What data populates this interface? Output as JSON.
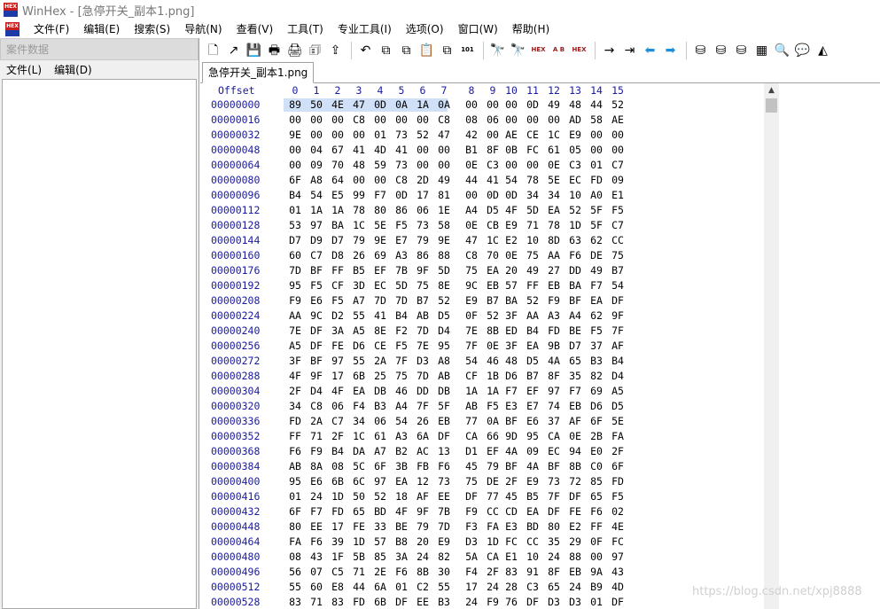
{
  "window": {
    "title": "WinHex - [急停开关_副本1.png]",
    "logo_text": "HEX"
  },
  "menu": [
    "文件(F)",
    "编辑(E)",
    "搜索(S)",
    "导航(N)",
    "查看(V)",
    "工具(T)",
    "专业工具(I)",
    "选项(O)",
    "窗口(W)",
    "帮助(H)"
  ],
  "left_panel": {
    "title": "案件数据",
    "menu": [
      "文件(L)",
      "编辑(D)"
    ]
  },
  "toolbar": {
    "groups": [
      [
        {
          "name": "new-file-icon",
          "glyph": "🗋"
        },
        {
          "name": "open-icon",
          "glyph": "↗"
        },
        {
          "name": "save-icon",
          "glyph": "💾"
        },
        {
          "name": "print-icon",
          "glyph": "🖶"
        },
        {
          "name": "properties-icon",
          "glyph": "🖨"
        },
        {
          "name": "open-disk-icon",
          "glyph": "🗊"
        },
        {
          "name": "export-icon",
          "glyph": "⇪"
        }
      ],
      [
        {
          "name": "undo-icon",
          "glyph": "↶"
        },
        {
          "name": "cut-icon",
          "glyph": "⧉"
        },
        {
          "name": "copy-icon",
          "glyph": "⧉"
        },
        {
          "name": "paste-icon",
          "glyph": "📋"
        },
        {
          "name": "write-icon",
          "glyph": "⧉"
        },
        {
          "name": "binary-icon",
          "glyph": "101"
        }
      ],
      [
        {
          "name": "find-icon",
          "glyph": "🔭"
        },
        {
          "name": "find-red-icon",
          "glyph": "🔭"
        },
        {
          "name": "find-hex-icon",
          "glyph": "HEX"
        },
        {
          "name": "replace-text-icon",
          "glyph": "A B"
        },
        {
          "name": "replace-hex-icon",
          "glyph": "HEX"
        }
      ],
      [
        {
          "name": "goto-arrow-icon",
          "glyph": "→"
        },
        {
          "name": "goto-offset-icon",
          "glyph": "⇥"
        },
        {
          "name": "back-icon",
          "glyph": "⬅"
        },
        {
          "name": "forward-icon",
          "glyph": "➡"
        }
      ],
      [
        {
          "name": "disk-editor-icon",
          "glyph": "⛁"
        },
        {
          "name": "disk-green-icon",
          "glyph": "⛁"
        },
        {
          "name": "disk-tool-icon",
          "glyph": "⛁"
        },
        {
          "name": "calculator-icon",
          "glyph": "▦"
        },
        {
          "name": "zoom-icon",
          "glyph": "🔍"
        },
        {
          "name": "speech-icon",
          "glyph": "💬"
        },
        {
          "name": "gray-shape-icon",
          "glyph": "◭"
        }
      ]
    ]
  },
  "tab": {
    "label": "急停开关_副本1.png"
  },
  "hex": {
    "offset_header": "Offset",
    "columns": [
      "0",
      "1",
      "2",
      "3",
      "4",
      "5",
      "6",
      "7",
      "8",
      "9",
      "10",
      "11",
      "12",
      "13",
      "14",
      "15"
    ],
    "rows": [
      {
        "offset": "00000000",
        "bytes": [
          "89",
          "50",
          "4E",
          "47",
          "0D",
          "0A",
          "1A",
          "0A",
          "00",
          "00",
          "00",
          "0D",
          "49",
          "48",
          "44",
          "52"
        ]
      },
      {
        "offset": "00000016",
        "bytes": [
          "00",
          "00",
          "00",
          "C8",
          "00",
          "00",
          "00",
          "C8",
          "08",
          "06",
          "00",
          "00",
          "00",
          "AD",
          "58",
          "AE"
        ]
      },
      {
        "offset": "00000032",
        "bytes": [
          "9E",
          "00",
          "00",
          "00",
          "01",
          "73",
          "52",
          "47",
          "42",
          "00",
          "AE",
          "CE",
          "1C",
          "E9",
          "00",
          "00"
        ]
      },
      {
        "offset": "00000048",
        "bytes": [
          "00",
          "04",
          "67",
          "41",
          "4D",
          "41",
          "00",
          "00",
          "B1",
          "8F",
          "0B",
          "FC",
          "61",
          "05",
          "00",
          "00"
        ]
      },
      {
        "offset": "00000064",
        "bytes": [
          "00",
          "09",
          "70",
          "48",
          "59",
          "73",
          "00",
          "00",
          "0E",
          "C3",
          "00",
          "00",
          "0E",
          "C3",
          "01",
          "C7"
        ]
      },
      {
        "offset": "00000080",
        "bytes": [
          "6F",
          "A8",
          "64",
          "00",
          "00",
          "C8",
          "2D",
          "49",
          "44",
          "41",
          "54",
          "78",
          "5E",
          "EC",
          "FD",
          "09"
        ]
      },
      {
        "offset": "00000096",
        "bytes": [
          "B4",
          "54",
          "E5",
          "99",
          "F7",
          "0D",
          "17",
          "81",
          "00",
          "0D",
          "0D",
          "34",
          "34",
          "10",
          "A0",
          "E1"
        ]
      },
      {
        "offset": "00000112",
        "bytes": [
          "01",
          "1A",
          "1A",
          "78",
          "80",
          "86",
          "06",
          "1E",
          "A4",
          "D5",
          "4F",
          "5D",
          "EA",
          "52",
          "5F",
          "F5"
        ]
      },
      {
        "offset": "00000128",
        "bytes": [
          "53",
          "97",
          "BA",
          "1C",
          "5E",
          "F5",
          "73",
          "58",
          "0E",
          "CB",
          "E9",
          "71",
          "78",
          "1D",
          "5F",
          "C7"
        ]
      },
      {
        "offset": "00000144",
        "bytes": [
          "D7",
          "D9",
          "D7",
          "79",
          "9E",
          "E7",
          "79",
          "9E",
          "47",
          "1C",
          "E2",
          "10",
          "8D",
          "63",
          "62",
          "CC"
        ]
      },
      {
        "offset": "00000160",
        "bytes": [
          "60",
          "C7",
          "D8",
          "26",
          "69",
          "A3",
          "86",
          "88",
          "C8",
          "70",
          "0E",
          "75",
          "AA",
          "F6",
          "DE",
          "75"
        ]
      },
      {
        "offset": "00000176",
        "bytes": [
          "7D",
          "BF",
          "FF",
          "B5",
          "EF",
          "7B",
          "9F",
          "5D",
          "75",
          "EA",
          "20",
          "49",
          "27",
          "DD",
          "49",
          "B7"
        ]
      },
      {
        "offset": "00000192",
        "bytes": [
          "95",
          "F5",
          "CF",
          "3D",
          "EC",
          "5D",
          "75",
          "8E",
          "9C",
          "EB",
          "57",
          "FF",
          "EB",
          "BA",
          "F7",
          "54"
        ]
      },
      {
        "offset": "00000208",
        "bytes": [
          "F9",
          "E6",
          "F5",
          "A7",
          "7D",
          "7D",
          "B7",
          "52",
          "E9",
          "B7",
          "BA",
          "52",
          "F9",
          "BF",
          "EA",
          "DF"
        ]
      },
      {
        "offset": "00000224",
        "bytes": [
          "AA",
          "9C",
          "D2",
          "55",
          "41",
          "B4",
          "AB",
          "D5",
          "0F",
          "52",
          "3F",
          "AA",
          "A3",
          "A4",
          "62",
          "9F"
        ]
      },
      {
        "offset": "00000240",
        "bytes": [
          "7E",
          "DF",
          "3A",
          "A5",
          "8E",
          "F2",
          "7D",
          "D4",
          "7E",
          "8B",
          "ED",
          "B4",
          "FD",
          "BE",
          "F5",
          "7F"
        ]
      },
      {
        "offset": "00000256",
        "bytes": [
          "A5",
          "DF",
          "FE",
          "D6",
          "CE",
          "F5",
          "7E",
          "95",
          "7F",
          "0E",
          "3F",
          "EA",
          "9B",
          "D7",
          "37",
          "AF"
        ]
      },
      {
        "offset": "00000272",
        "bytes": [
          "3F",
          "BF",
          "97",
          "55",
          "2A",
          "7F",
          "D3",
          "A8",
          "54",
          "46",
          "48",
          "D5",
          "4A",
          "65",
          "B3",
          "B4"
        ]
      },
      {
        "offset": "00000288",
        "bytes": [
          "4F",
          "9F",
          "17",
          "6B",
          "25",
          "75",
          "7D",
          "AB",
          "CF",
          "1B",
          "D6",
          "B7",
          "8F",
          "35",
          "82",
          "D4"
        ]
      },
      {
        "offset": "00000304",
        "bytes": [
          "2F",
          "D4",
          "4F",
          "EA",
          "DB",
          "46",
          "DD",
          "DB",
          "1A",
          "1A",
          "F7",
          "EF",
          "97",
          "F7",
          "69",
          "A5"
        ]
      },
      {
        "offset": "00000320",
        "bytes": [
          "34",
          "C8",
          "06",
          "F4",
          "B3",
          "A4",
          "7F",
          "5F",
          "AB",
          "F5",
          "E3",
          "E7",
          "74",
          "EB",
          "D6",
          "D5"
        ]
      },
      {
        "offset": "00000336",
        "bytes": [
          "FD",
          "2A",
          "C7",
          "34",
          "06",
          "54",
          "26",
          "EB",
          "77",
          "0A",
          "BF",
          "E6",
          "37",
          "AF",
          "6F",
          "5E"
        ]
      },
      {
        "offset": "00000352",
        "bytes": [
          "FF",
          "71",
          "2F",
          "1C",
          "61",
          "A3",
          "6A",
          "DF",
          "CA",
          "66",
          "9D",
          "95",
          "CA",
          "0E",
          "2B",
          "FA"
        ]
      },
      {
        "offset": "00000368",
        "bytes": [
          "F6",
          "F9",
          "B4",
          "DA",
          "A7",
          "B2",
          "AC",
          "13",
          "D1",
          "EF",
          "4A",
          "09",
          "EC",
          "94",
          "E0",
          "2F"
        ]
      },
      {
        "offset": "00000384",
        "bytes": [
          "AB",
          "8A",
          "08",
          "5C",
          "6F",
          "3B",
          "FB",
          "F6",
          "45",
          "79",
          "BF",
          "4A",
          "BF",
          "8B",
          "C0",
          "6F"
        ]
      },
      {
        "offset": "00000400",
        "bytes": [
          "95",
          "E6",
          "6B",
          "6C",
          "97",
          "EA",
          "12",
          "73",
          "75",
          "DE",
          "2F",
          "E9",
          "73",
          "72",
          "85",
          "FD"
        ]
      },
      {
        "offset": "00000416",
        "bytes": [
          "01",
          "24",
          "1D",
          "50",
          "52",
          "18",
          "AF",
          "EE",
          "DF",
          "77",
          "45",
          "B5",
          "7F",
          "DF",
          "65",
          "F5"
        ]
      },
      {
        "offset": "00000432",
        "bytes": [
          "6F",
          "F7",
          "FD",
          "65",
          "BD",
          "4F",
          "9F",
          "7B",
          "F9",
          "CC",
          "CD",
          "EA",
          "DF",
          "FE",
          "F6",
          "02"
        ]
      },
      {
        "offset": "00000448",
        "bytes": [
          "80",
          "EE",
          "17",
          "FE",
          "33",
          "BE",
          "79",
          "7D",
          "F3",
          "FA",
          "E3",
          "BD",
          "80",
          "E2",
          "FF",
          "4E"
        ]
      },
      {
        "offset": "00000464",
        "bytes": [
          "FA",
          "F6",
          "39",
          "1D",
          "57",
          "B8",
          "20",
          "E9",
          "D3",
          "1D",
          "FC",
          "CC",
          "35",
          "29",
          "0F",
          "FC"
        ]
      },
      {
        "offset": "00000480",
        "bytes": [
          "08",
          "43",
          "1F",
          "5B",
          "85",
          "3A",
          "24",
          "82",
          "5A",
          "CA",
          "E1",
          "10",
          "24",
          "88",
          "00",
          "97"
        ]
      },
      {
        "offset": "00000496",
        "bytes": [
          "56",
          "07",
          "C5",
          "71",
          "2E",
          "F6",
          "8B",
          "30",
          "F4",
          "2F",
          "83",
          "91",
          "8F",
          "EB",
          "9A",
          "43"
        ]
      },
      {
        "offset": "00000512",
        "bytes": [
          "55",
          "60",
          "E8",
          "44",
          "6A",
          "01",
          "C2",
          "55",
          "17",
          "24",
          "28",
          "C3",
          "65",
          "24",
          "B9",
          "4D"
        ]
      },
      {
        "offset": "00000528",
        "bytes": [
          "83",
          "71",
          "83",
          "FD",
          "6B",
          "DF",
          "EE",
          "B3",
          "24",
          "F9",
          "76",
          "DF",
          "D3",
          "D3",
          "01",
          "DF"
        ]
      }
    ]
  },
  "watermark": "https://blog.csdn.net/xpj8888"
}
